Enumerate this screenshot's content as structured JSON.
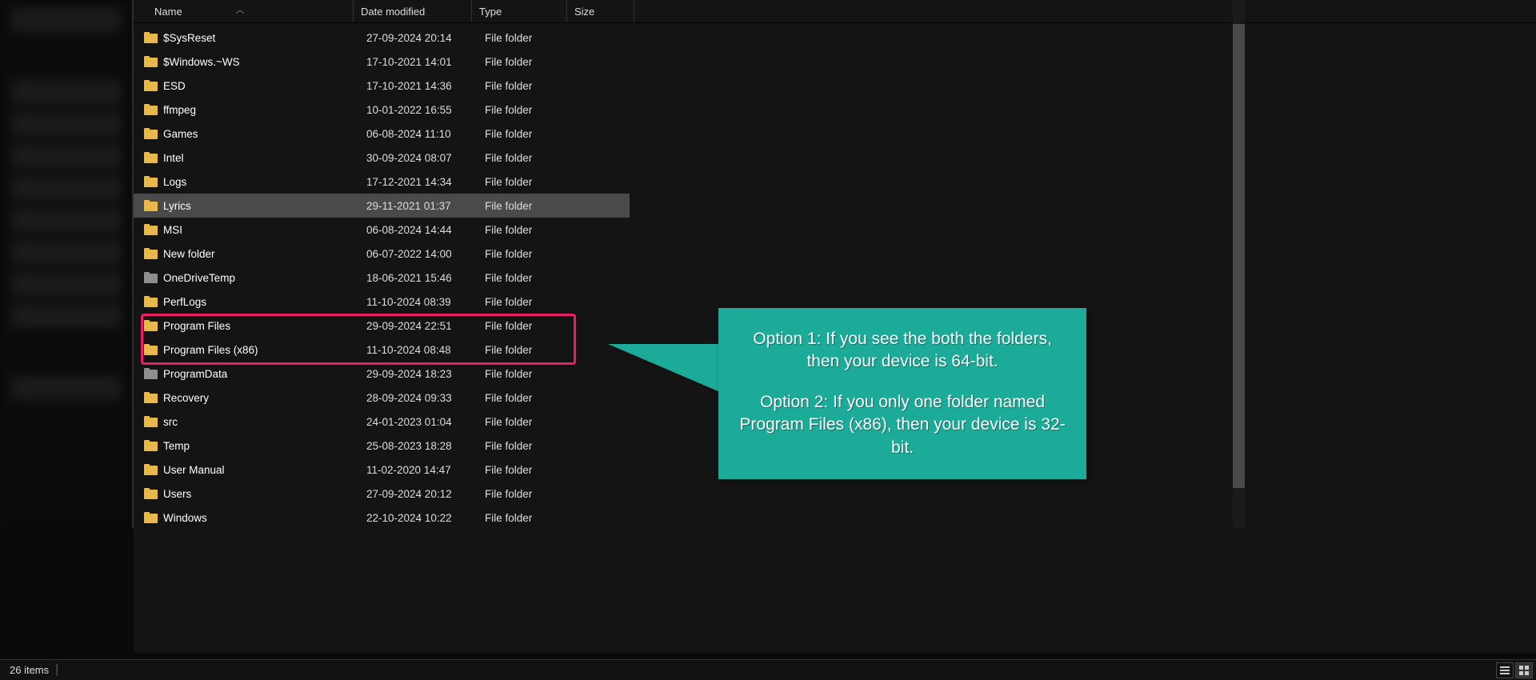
{
  "columns": {
    "name": "Name",
    "date": "Date modified",
    "type": "Type",
    "size": "Size"
  },
  "items": [
    {
      "name": "$SysReset",
      "date": "27-09-2024 20:14",
      "type": "File folder",
      "icon": "yellow"
    },
    {
      "name": "$Windows.~WS",
      "date": "17-10-2021 14:01",
      "type": "File folder",
      "icon": "yellow"
    },
    {
      "name": "ESD",
      "date": "17-10-2021 14:36",
      "type": "File folder",
      "icon": "yellow"
    },
    {
      "name": "ffmpeg",
      "date": "10-01-2022 16:55",
      "type": "File folder",
      "icon": "yellow"
    },
    {
      "name": "Games",
      "date": "06-08-2024 11:10",
      "type": "File folder",
      "icon": "yellow"
    },
    {
      "name": "Intel",
      "date": "30-09-2024 08:07",
      "type": "File folder",
      "icon": "yellow"
    },
    {
      "name": "Logs",
      "date": "17-12-2021 14:34",
      "type": "File folder",
      "icon": "yellow"
    },
    {
      "name": "Lyrics",
      "date": "29-11-2021 01:37",
      "type": "File folder",
      "icon": "yellow",
      "hovered": true
    },
    {
      "name": "MSI",
      "date": "06-08-2024 14:44",
      "type": "File folder",
      "icon": "yellow"
    },
    {
      "name": "New folder",
      "date": "06-07-2022 14:00",
      "type": "File folder",
      "icon": "yellow"
    },
    {
      "name": "OneDriveTemp",
      "date": "18-06-2021 15:46",
      "type": "File folder",
      "icon": "gray"
    },
    {
      "name": "PerfLogs",
      "date": "11-10-2024 08:39",
      "type": "File folder",
      "icon": "yellow"
    },
    {
      "name": "Program Files",
      "date": "29-09-2024 22:51",
      "type": "File folder",
      "icon": "yellow"
    },
    {
      "name": "Program Files (x86)",
      "date": "11-10-2024 08:48",
      "type": "File folder",
      "icon": "yellow"
    },
    {
      "name": "ProgramData",
      "date": "29-09-2024 18:23",
      "type": "File folder",
      "icon": "gray"
    },
    {
      "name": "Recovery",
      "date": "28-09-2024 09:33",
      "type": "File folder",
      "icon": "yellow"
    },
    {
      "name": "src",
      "date": "24-01-2023 01:04",
      "type": "File folder",
      "icon": "yellow"
    },
    {
      "name": "Temp",
      "date": "25-08-2023 18:28",
      "type": "File folder",
      "icon": "yellow"
    },
    {
      "name": "User Manual",
      "date": "11-02-2020 14:47",
      "type": "File folder",
      "icon": "yellow"
    },
    {
      "name": "Users",
      "date": "27-09-2024 20:12",
      "type": "File folder",
      "icon": "yellow"
    },
    {
      "name": "Windows",
      "date": "22-10-2024 10:22",
      "type": "File folder",
      "icon": "yellow"
    }
  ],
  "callout": {
    "line1": "Option 1: If you see the both the folders, then your device is 64-bit.",
    "line2": "Option 2: If you only one folder named Program Files (x86), then your device is 32-bit."
  },
  "status": {
    "count": "26 items"
  }
}
